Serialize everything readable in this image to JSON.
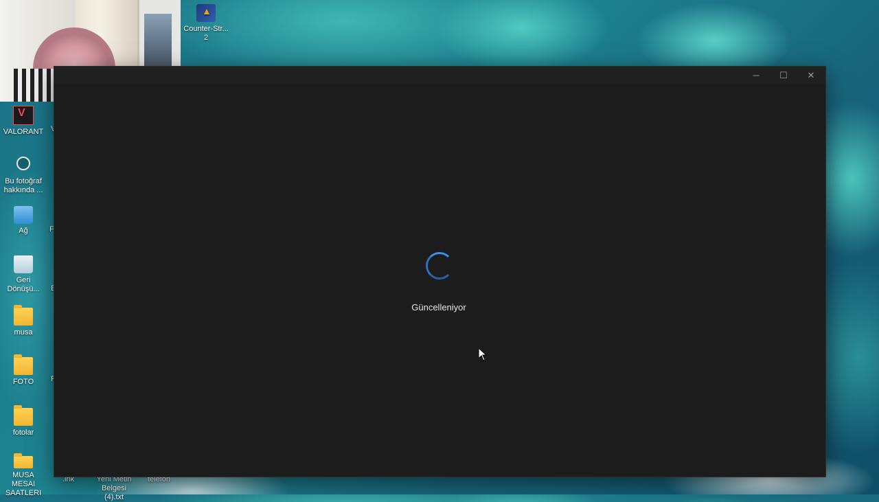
{
  "desktop": {
    "icons": [
      {
        "label": "Counter-Str... 2"
      },
      {
        "label": "VALORANT"
      },
      {
        "label": "Bu fotoğraf hakkında ..."
      },
      {
        "label": "Ağ"
      },
      {
        "label": "Geri Dönüşü..."
      },
      {
        "label": "musa"
      },
      {
        "label": "FOTO"
      },
      {
        "label": "fotolar"
      },
      {
        "label": "MUSA MESAI SAATLERI"
      }
    ],
    "partial_labels": [
      "V",
      "F",
      "E",
      "F"
    ],
    "bottom_row": [
      ".lnk",
      "Yeni Metin Belgesi (4).txt",
      "telefon"
    ]
  },
  "app": {
    "status": "Güncelleniyor",
    "controls": {
      "minimize": "─",
      "maximize": "☐",
      "close": "✕"
    }
  },
  "colors": {
    "window_bg": "#1c1c1c",
    "spinner": "#3a8fe0"
  }
}
